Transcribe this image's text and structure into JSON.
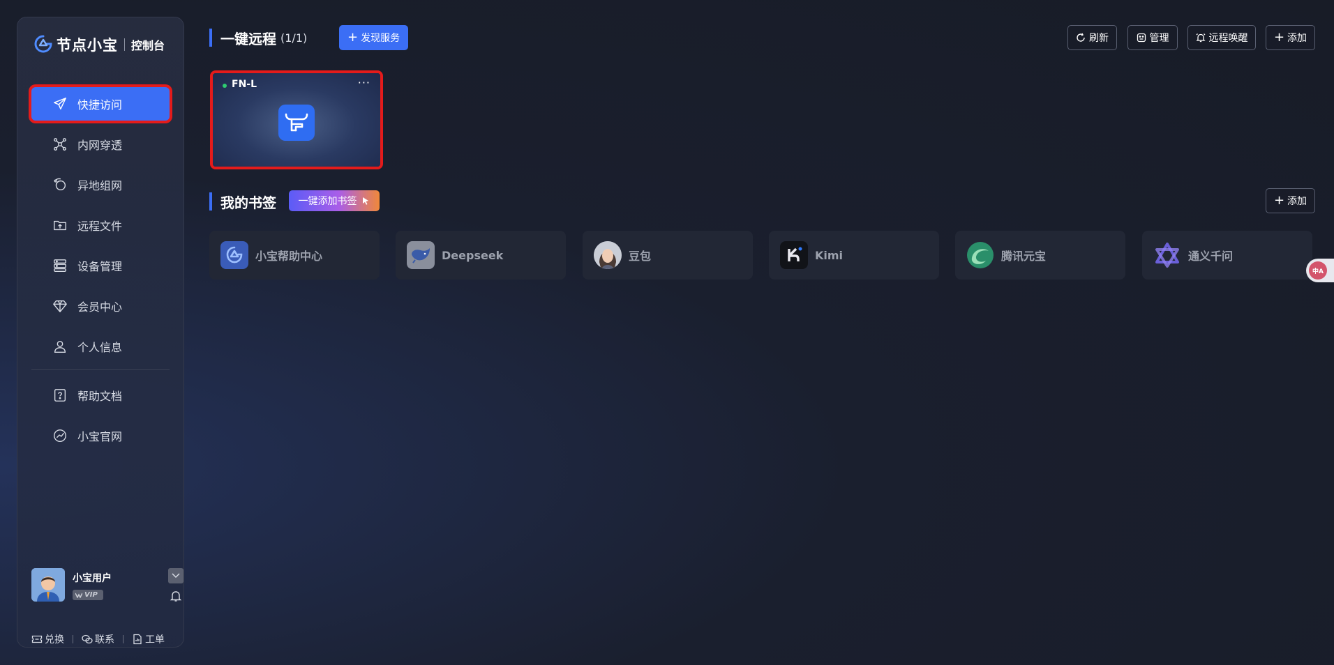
{
  "brand": {
    "name": "节点小宝",
    "sub": "控制台"
  },
  "sidebar": {
    "items": [
      {
        "label": "快捷访问",
        "icon": "paper-plane-icon"
      },
      {
        "label": "内网穿透",
        "icon": "network-nodes-icon"
      },
      {
        "label": "异地组网",
        "icon": "globe-link-icon"
      },
      {
        "label": "远程文件",
        "icon": "folder-upload-icon"
      },
      {
        "label": "设备管理",
        "icon": "server-stack-icon"
      },
      {
        "label": "会员中心",
        "icon": "diamond-icon"
      },
      {
        "label": "个人信息",
        "icon": "user-icon"
      },
      {
        "label": "帮助文档",
        "icon": "help-doc-icon"
      },
      {
        "label": "小宝官网",
        "icon": "website-icon"
      }
    ],
    "active_index": 0
  },
  "user": {
    "name": "小宝用户",
    "badge": "VIP"
  },
  "footer": {
    "redeem": "兑换",
    "contact": "联系",
    "ticket": "工单"
  },
  "remote": {
    "title": "一键远程",
    "count": "(1/1)",
    "discover_btn": "发现服务",
    "toolbar": {
      "refresh": "刷新",
      "manage": "管理",
      "wake": "远程唤醒",
      "add": "添加"
    },
    "devices": [
      {
        "name": "FN-L",
        "status": "online",
        "more": "···"
      }
    ]
  },
  "bookmarks": {
    "title": "我的书签",
    "quick_add_btn": "一键添加书签",
    "add_btn": "添加",
    "items": [
      {
        "label": "小宝帮助中心",
        "icon": "xiaobao-logo-icon"
      },
      {
        "label": "Deepseek",
        "icon": "deepseek-whale-icon"
      },
      {
        "label": "豆包",
        "icon": "doubao-avatar-icon"
      },
      {
        "label": "Kimi",
        "icon": "kimi-logo-icon"
      },
      {
        "label": "腾讯元宝",
        "icon": "yuanbao-logo-icon"
      },
      {
        "label": "通义千问",
        "icon": "tongyi-logo-icon"
      }
    ]
  },
  "translate": {
    "label": "中A"
  },
  "colors": {
    "accent": "#3b6ef5",
    "highlight": "#e41b1b",
    "online": "#2ecc71"
  }
}
